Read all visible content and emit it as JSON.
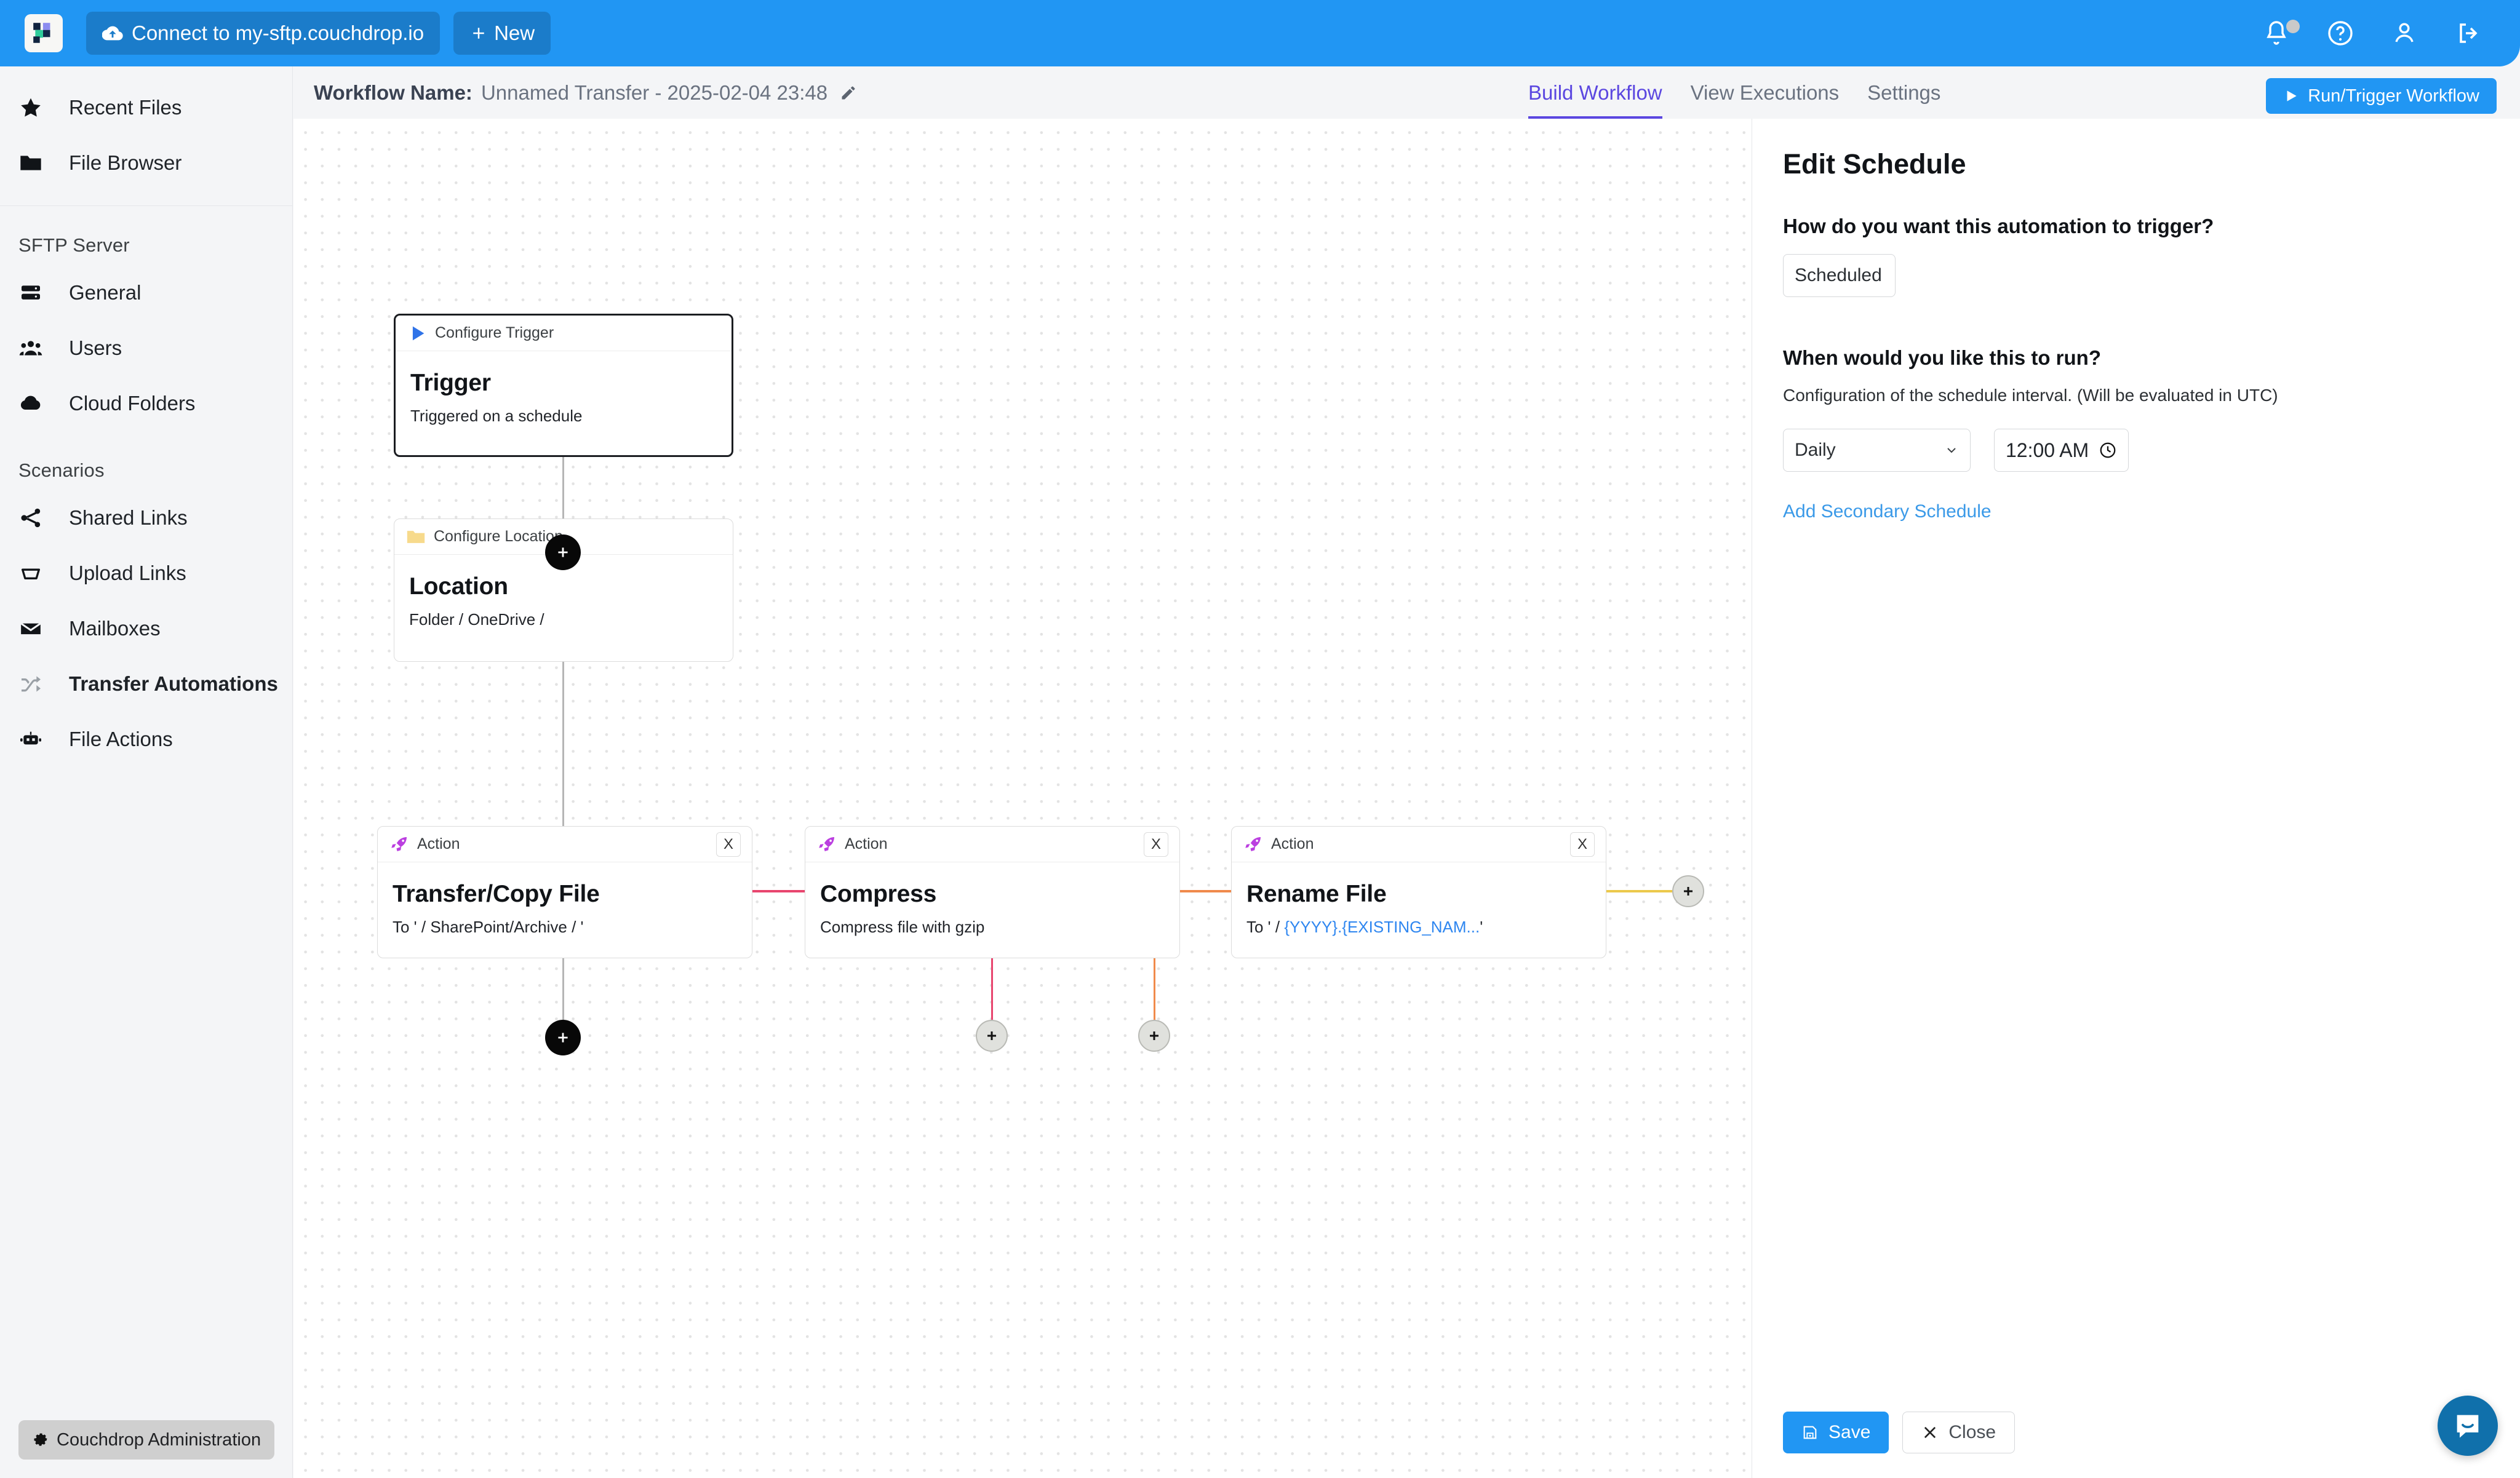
{
  "topbar": {
    "logo_name": "couchdrop-logo",
    "connect_label": "Connect to my-sftp.couchdrop.io",
    "new_label": "New",
    "icons": [
      "bell-icon",
      "help-circle-icon",
      "user-icon",
      "logout-icon"
    ],
    "accent": "#2196f3"
  },
  "sidebar": {
    "primary": [
      {
        "label": "Recent Files",
        "icon": "star-icon"
      },
      {
        "label": "File Browser",
        "icon": "folder-icon"
      }
    ],
    "sections": [
      {
        "heading": "SFTP Server",
        "items": [
          {
            "label": "General",
            "icon": "server-icon"
          },
          {
            "label": "Users",
            "icon": "users-icon"
          },
          {
            "label": "Cloud Folders",
            "icon": "cloud-icon"
          }
        ]
      },
      {
        "heading": "Scenarios",
        "items": [
          {
            "label": "Shared Links",
            "icon": "share-icon"
          },
          {
            "label": "Upload Links",
            "icon": "inbox-icon"
          },
          {
            "label": "Mailboxes",
            "icon": "envelope-icon"
          },
          {
            "label": "Transfer Automations",
            "icon": "shuffle-icon",
            "active": true
          },
          {
            "label": "File Actions",
            "icon": "robot-icon"
          }
        ]
      }
    ],
    "admin_label": "Couchdrop Administration"
  },
  "workflow_header": {
    "name_label": "Workflow Name:",
    "name_value": "Unnamed Transfer - 2025-02-04 23:48",
    "edit_icon": "pencil-icon",
    "tabs": [
      {
        "label": "Build Workflow",
        "active": true
      },
      {
        "label": "View Executions",
        "active": false
      },
      {
        "label": "Settings",
        "active": false
      }
    ],
    "run_label": "Run/Trigger Workflow",
    "active_tab_color": "#5b47e0"
  },
  "canvas": {
    "nodes": [
      {
        "header": "Configure Trigger",
        "header_icon": "play-triangle-icon",
        "title": "Trigger",
        "subtitle": "Triggered on a schedule",
        "closable": false
      },
      {
        "header": "Configure Location",
        "header_icon": "folder-icon",
        "title": "Location",
        "subtitle": "Folder / OneDrive /",
        "closable": false
      },
      {
        "header": "Action",
        "header_icon": "rocket-icon",
        "title": "Transfer/Copy File",
        "subtitle_prefix": "To ' / SharePoint/Archive / '",
        "subtitle_token": "",
        "subtitle_suffix": "",
        "closable": true,
        "close_label": "X"
      },
      {
        "header": "Action",
        "header_icon": "rocket-icon",
        "title": "Compress",
        "subtitle_prefix": "Compress file with gzip",
        "subtitle_token": "",
        "subtitle_suffix": "",
        "closable": true,
        "close_label": "X"
      },
      {
        "header": "Action",
        "header_icon": "rocket-icon",
        "title": "Rename File",
        "subtitle_prefix": "To ' / ",
        "subtitle_token": "{YYYY}.{EXISTING_NAM...",
        "subtitle_suffix": "'",
        "closable": true,
        "close_label": "X"
      }
    ],
    "edge_colors": {
      "trunk": "#b6b6b6",
      "pink": "#e8456e",
      "orange": "#f08a4b",
      "yellow": "#ecc94b"
    },
    "add_buttons": {
      "dark_count": 2,
      "light_count": 4,
      "glyph": "+"
    }
  },
  "panel": {
    "title": "Edit Schedule",
    "question_trigger": "How do you want this automation to trigger?",
    "trigger_select_value": "Scheduled",
    "question_when": "When would you like this to run?",
    "schedule_note": "Configuration of the schedule interval. (Will be evaluated in UTC)",
    "interval_select_value": "Daily",
    "time_value": "12:00 AM",
    "time_icon": "clock-icon",
    "add_secondary_label": "Add Secondary Schedule",
    "save_label": "Save",
    "save_icon": "floppy-icon",
    "close_label": "Close",
    "close_icon": "x-icon",
    "link_color": "#3b9ae8"
  },
  "intercom": {
    "icon": "chat-bubble-icon",
    "color": "#1070ab"
  }
}
